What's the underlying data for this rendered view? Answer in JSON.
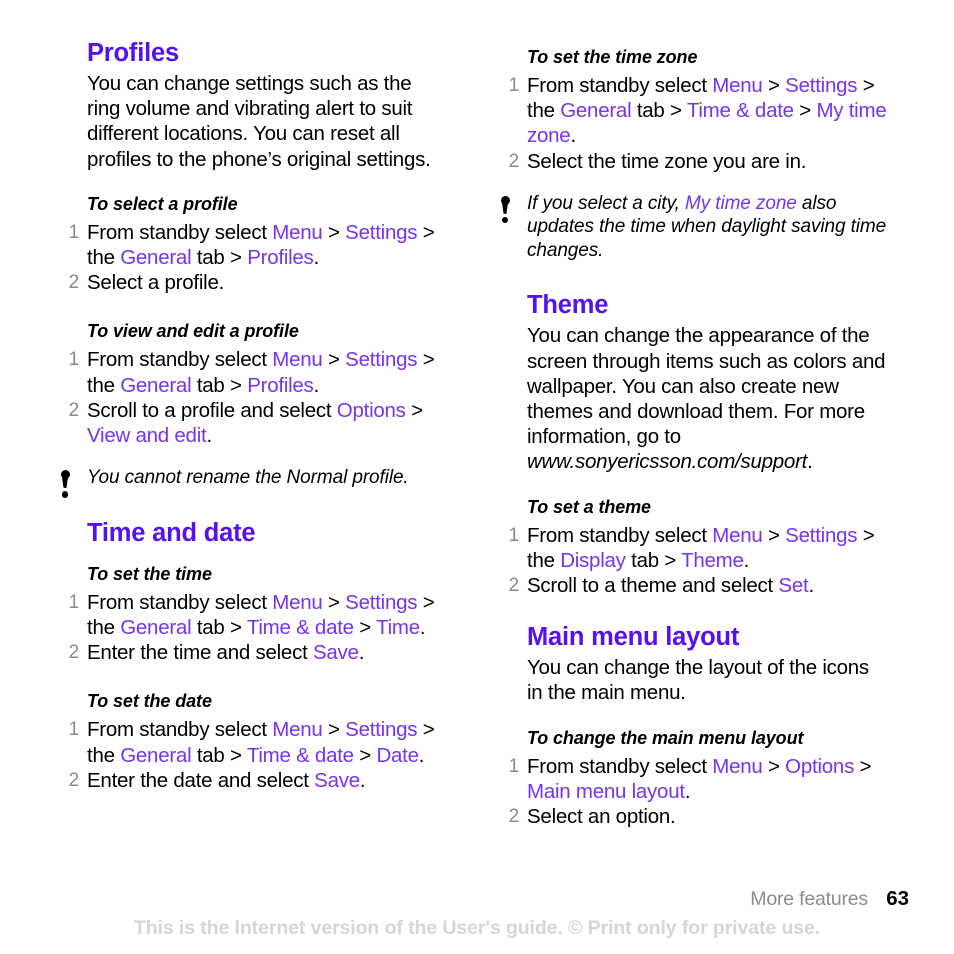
{
  "colors": {
    "heading_purple": "#5511ee",
    "link_purple": "#7733ee",
    "step_number_gray": "#8a8a8a",
    "footer_gray": "#8c8c8c",
    "watermark_gray": "#d6d6d6"
  },
  "left_column": {
    "profiles": {
      "title": "Profiles",
      "intro": "You can change settings such as the ring volume and vibrating alert to suit different locations. You can reset all profiles to the phone’s original settings.",
      "select_profile": {
        "heading": "To select a profile",
        "step1": {
          "num": "1",
          "t1": "From standby select ",
          "l1": "Menu",
          "t2": " > ",
          "l2": "Settings",
          "t3": " > the ",
          "l3": "General",
          "t4": " tab > ",
          "l4": "Profiles",
          "t5": "."
        },
        "step2": {
          "num": "2",
          "t1": "Select a profile."
        }
      },
      "view_edit_profile": {
        "heading": "To view and edit a profile",
        "step1": {
          "num": "1",
          "t1": "From standby select ",
          "l1": "Menu",
          "t2": " > ",
          "l2": "Settings",
          "t3": " > the ",
          "l3": "General",
          "t4": " tab > ",
          "l4": "Profiles",
          "t5": "."
        },
        "step2": {
          "num": "2",
          "t1": "Scroll to a profile and select ",
          "l1": "Options",
          "t2": " > ",
          "l2": "View and edit",
          "t3": "."
        }
      },
      "note": "You cannot rename the Normal profile."
    },
    "time_and_date": {
      "title": "Time and date",
      "set_time": {
        "heading": "To set the time",
        "step1": {
          "num": "1",
          "t1": "From standby select ",
          "l1": "Menu",
          "t2": " > ",
          "l2": "Settings",
          "t3": " > the ",
          "l3": "General",
          "t4": " tab > ",
          "l4": "Time & date",
          "t5": " > ",
          "l5": "Time",
          "t6": "."
        },
        "step2": {
          "num": "2",
          "t1": "Enter the time and select ",
          "l1": "Save",
          "t2": "."
        }
      },
      "set_date": {
        "heading": "To set the date",
        "step1": {
          "num": "1",
          "t1": "From standby select ",
          "l1": "Menu",
          "t2": " > ",
          "l2": "Settings",
          "t3": " > the ",
          "l3": "General",
          "t4": " tab > ",
          "l4": "Time & date",
          "t5": " > ",
          "l5": "Date",
          "t6": "."
        },
        "step2": {
          "num": "2",
          "t1": "Enter the date and select ",
          "l1": "Save",
          "t2": "."
        }
      }
    }
  },
  "right_column": {
    "set_time_zone": {
      "heading": "To set the time zone",
      "step1": {
        "num": "1",
        "t1": "From standby select ",
        "l1": "Menu",
        "t2": " > ",
        "l2": "Settings",
        "t3": " > the ",
        "l3": "General",
        "t4": " tab > ",
        "l4": "Time & date",
        "t5": " > ",
        "l5": "My time zone",
        "t6": "."
      },
      "step2": {
        "num": "2",
        "t1": "Select the time zone you are in."
      },
      "note": {
        "t1": "If you select a city, ",
        "l1": "My time zone",
        "t2": " also updates the time when daylight saving time changes."
      }
    },
    "theme": {
      "title": "Theme",
      "intro_t1": "You can change the appearance of the screen through items such as colors and wallpaper. You can also create new themes and download them. For more information, go to ",
      "intro_url": "www.sonyericsson.com/support",
      "intro_t2": ".",
      "set_theme": {
        "heading": "To set a theme",
        "step1": {
          "num": "1",
          "t1": "From standby select ",
          "l1": "Menu",
          "t2": " > ",
          "l2": "Settings",
          "t3": " > the ",
          "l3": "Display",
          "t4": " tab > ",
          "l4": "Theme",
          "t5": "."
        },
        "step2": {
          "num": "2",
          "t1": "Scroll to a theme and select ",
          "l1": "Set",
          "t2": "."
        }
      }
    },
    "main_menu_layout": {
      "title": "Main menu layout",
      "intro": "You can change the layout of the icons in the main menu.",
      "change_layout": {
        "heading": "To change the main menu layout",
        "step1": {
          "num": "1",
          "t1": "From standby select ",
          "l1": "Menu",
          "t2": " > ",
          "l2": "Options",
          "t3": " > ",
          "l3": "Main menu layout",
          "t4": "."
        },
        "step2": {
          "num": "2",
          "t1": "Select an option."
        }
      }
    }
  },
  "footer": {
    "chapter": "More features",
    "page_number": "63",
    "watermark": "This is the Internet version of the User's guide. © Print only for private use."
  }
}
